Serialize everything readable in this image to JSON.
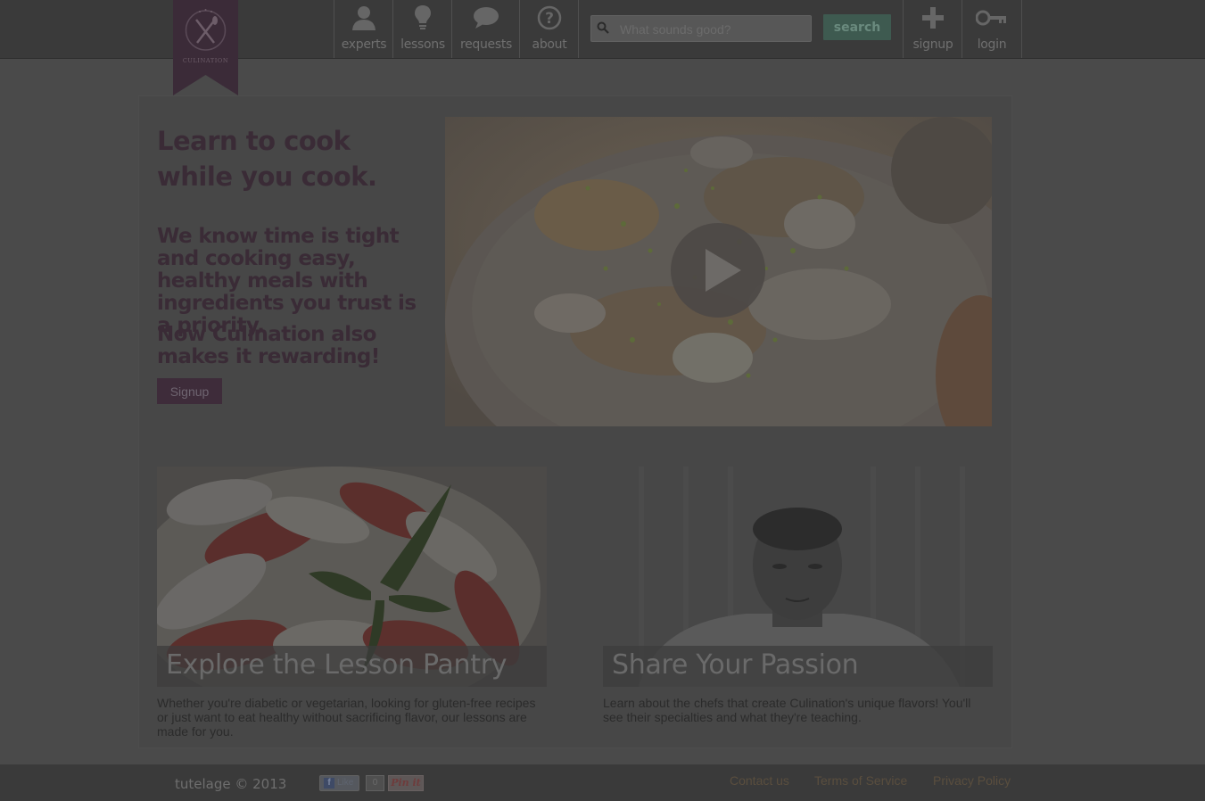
{
  "brand": {
    "name": "CULINATION"
  },
  "nav": {
    "items": [
      {
        "label": "experts",
        "icon": "person-icon"
      },
      {
        "label": "lessons",
        "icon": "lightbulb-icon"
      },
      {
        "label": "requests",
        "icon": "speech-bubble-icon"
      },
      {
        "label": "about",
        "icon": "question-circle-icon"
      }
    ],
    "search": {
      "placeholder": "What sounds good?",
      "button_label": "search"
    },
    "right_items": [
      {
        "label": "signup",
        "icon": "plus-icon"
      },
      {
        "label": "login",
        "icon": "key-icon"
      }
    ]
  },
  "hero": {
    "title": "Learn to cook while you cook.",
    "text": "We know time is tight and cooking easy, healthy meals with ingredients you trust is a priority.",
    "text2": "Now Culination also makes it rewarding!",
    "signup_label": "Signup"
  },
  "cards": [
    {
      "title": "Explore the Lesson Pantry",
      "text": "Whether you're diabetic or vegetarian, looking for gluten-free recipes or just want to eat healthy without sacrificing flavor, our lessons are made for you."
    },
    {
      "title": "Share Your Passion",
      "text": "Learn about the chefs that create Culination's unique flavors!  You'll see their specialties and what they're teaching."
    }
  ],
  "footer": {
    "copyright": "tutelage © 2013",
    "like_label": "Like",
    "like_count": "0",
    "pin_label": "Pin it",
    "links": [
      "Contact us",
      "Terms of Service",
      "Privacy Policy"
    ]
  },
  "colors": {
    "accent": "#3e2c3a",
    "search_button": "#3e5a50",
    "topbar": "#3a3a3a"
  }
}
